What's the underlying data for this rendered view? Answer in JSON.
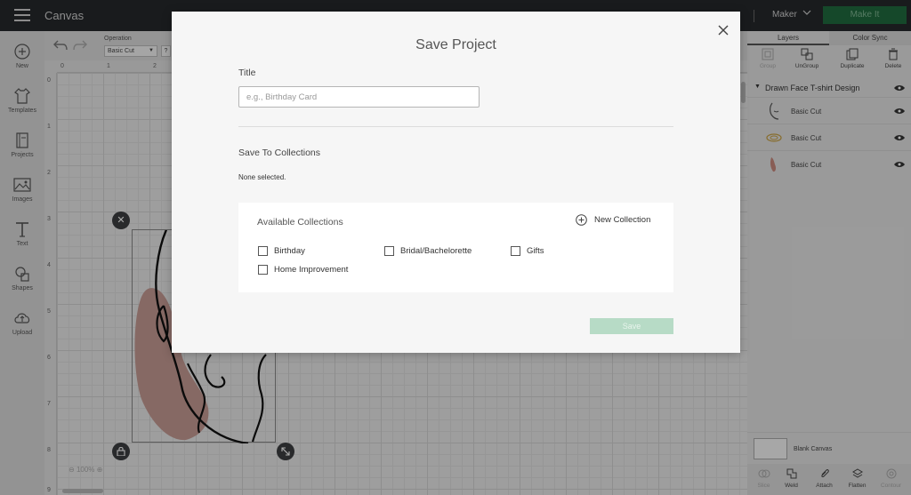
{
  "topbar": {
    "title": "Canvas",
    "machine": "Maker",
    "make_it": "Make It"
  },
  "left_rail": {
    "items": [
      {
        "label": "New",
        "icon": "plus-circle-icon"
      },
      {
        "label": "Templates",
        "icon": "tshirt-icon"
      },
      {
        "label": "Projects",
        "icon": "notebook-icon"
      },
      {
        "label": "Images",
        "icon": "image-icon"
      },
      {
        "label": "Text",
        "icon": "text-t-icon"
      },
      {
        "label": "Shapes",
        "icon": "shapes-icon"
      },
      {
        "label": "Upload",
        "icon": "cloud-upload-icon"
      }
    ]
  },
  "toolbar": {
    "operation_label": "Operation",
    "operation_value": "Basic Cut",
    "help": "?"
  },
  "rulers": {
    "h": [
      "0",
      "1",
      "2"
    ],
    "v": [
      "0",
      "1",
      "2",
      "3",
      "4",
      "5",
      "6",
      "7",
      "8",
      "9"
    ]
  },
  "canvas": {
    "zoom": "100%"
  },
  "right_panel": {
    "tabs": [
      "Layers",
      "Color Sync"
    ],
    "layer_tools": [
      {
        "label": "Group",
        "enabled": false
      },
      {
        "label": "UnGroup",
        "enabled": true
      },
      {
        "label": "Duplicate",
        "enabled": true
      },
      {
        "label": "Delete",
        "enabled": true
      }
    ],
    "group_name": "Drawn Face T-shirt Design",
    "layers": [
      {
        "name": "Basic Cut",
        "color": "#555555"
      },
      {
        "name": "Basic Cut",
        "color": "#c9a347"
      },
      {
        "name": "Basic Cut",
        "color": "#c98a7e"
      }
    ],
    "blank_canvas": "Blank Canvas",
    "bottom_tools": [
      {
        "label": "Slice",
        "enabled": false
      },
      {
        "label": "Weld",
        "enabled": true
      },
      {
        "label": "Attach",
        "enabled": true
      },
      {
        "label": "Flatten",
        "enabled": true
      },
      {
        "label": "Contour",
        "enabled": false
      }
    ]
  },
  "modal": {
    "title": "Save Project",
    "title_label": "Title",
    "title_value": "",
    "title_placeholder": "e.g., Birthday Card",
    "save_to_collections_label": "Save To Collections",
    "none_selected": "None selected.",
    "available_collections_label": "Available Collections",
    "new_collection_label": "New Collection",
    "collections": [
      {
        "label": "Birthday",
        "checked": false
      },
      {
        "label": "Bridal/Bachelorette",
        "checked": false
      },
      {
        "label": "Gifts",
        "checked": false
      },
      {
        "label": "Home Improvement",
        "checked": false
      }
    ],
    "save_label": "Save"
  },
  "colors": {
    "make_it_green": "#1f6a3e",
    "save_disabled_green": "#b7dbc6",
    "art_fill": "#c69b94"
  }
}
